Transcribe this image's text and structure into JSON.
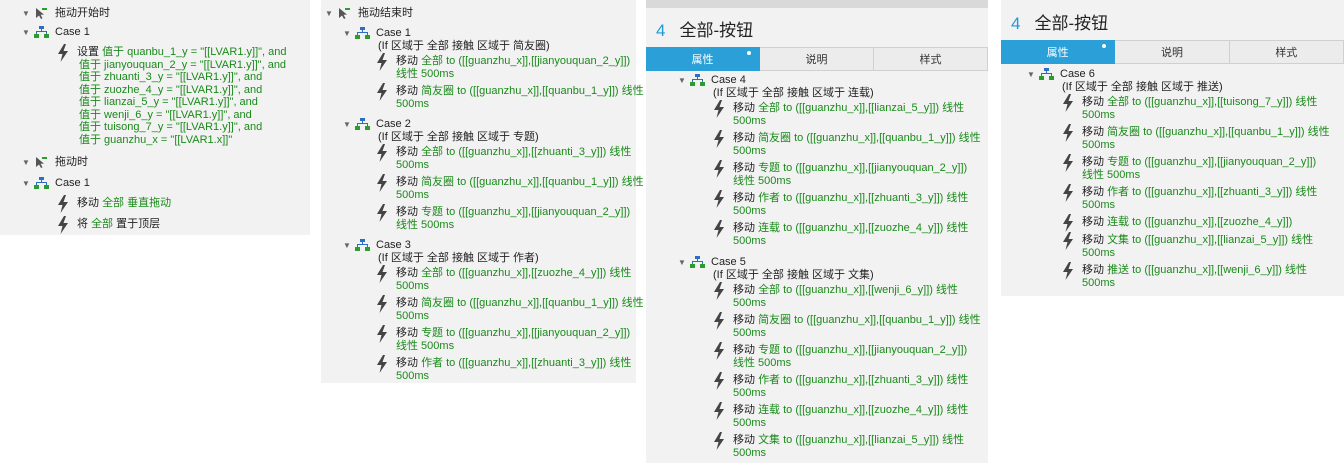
{
  "panel1": {
    "event1": "拖动开始时",
    "case1": "Case 1",
    "set_lines": [
      {
        "a": "设置 ",
        "g": "值于 quanbu_1_y = \"[[LVAR1.y]]\", and"
      },
      {
        "a": "",
        "g": "值于 jianyouquan_2_y = \"[[LVAR1.y]]\", and"
      },
      {
        "a": "",
        "g": "值于 zhuanti_3_y = \"[[LVAR1.y]]\", and"
      },
      {
        "a": "",
        "g": "值于 zuozhe_4_y = \"[[LVAR1.y]]\", and"
      },
      {
        "a": "",
        "g": "值于 lianzai_5_y = \"[[LVAR1.y]]\", and"
      },
      {
        "a": "",
        "g": "值于 wenji_6_y = \"[[LVAR1.y]]\", and"
      },
      {
        "a": "",
        "g": "值于 tuisong_7_y = \"[[LVAR1.y]]\", and"
      },
      {
        "a": "",
        "g": "值于 guanzhu_x = \"[[LVAR1.x]]\""
      }
    ],
    "event2": "拖动时",
    "case2": "Case 1",
    "act1": {
      "a": "移动 ",
      "g": "全部 垂直拖动"
    },
    "act2": {
      "a": "将 ",
      "g": "全部",
      "b": " 置于顶层"
    }
  },
  "panel2": {
    "event": "拖动结束时",
    "cases": [
      {
        "name": "Case 1",
        "cond": "(If 区域于 全部 接触 区域于 简友圈)",
        "acts": [
          {
            "a": "移动 ",
            "g": "全部 to ([[guanzhu_x]],[[jianyouquan_2_y]])",
            "g2": "线性 500ms"
          },
          {
            "a": "移动 ",
            "g": "简友圈 to ([[guanzhu_x]],[[quanbu_1_y]]) 线性",
            "g2": "500ms"
          }
        ]
      },
      {
        "name": "Case 2",
        "cond": "(If 区域于 全部 接触 区域于 专题)",
        "acts": [
          {
            "a": "移动 ",
            "g": "全部 to ([[guanzhu_x]],[[zhuanti_3_y]]) 线性",
            "g2": "500ms"
          },
          {
            "a": "移动 ",
            "g": "简友圈 to ([[guanzhu_x]],[[quanbu_1_y]]) 线性",
            "g2": "500ms"
          },
          {
            "a": "移动 ",
            "g": "专题 to ([[guanzhu_x]],[[jianyouquan_2_y]])",
            "g2": "线性 500ms"
          }
        ]
      },
      {
        "name": "Case 3",
        "cond": "(If 区域于 全部 接触 区域于 作者)",
        "acts": [
          {
            "a": "移动 ",
            "g": "全部 to ([[guanzhu_x]],[[zuozhe_4_y]]) 线性",
            "g2": "500ms"
          },
          {
            "a": "移动 ",
            "g": "简友圈 to ([[guanzhu_x]],[[quanbu_1_y]]) 线性",
            "g2": "500ms"
          },
          {
            "a": "移动 ",
            "g": "专题 to ([[guanzhu_x]],[[jianyouquan_2_y]])",
            "g2": "线性 500ms"
          },
          {
            "a": "移动 ",
            "g": "作者 to ([[guanzhu_x]],[[zhuanti_3_y]]) 线性",
            "g2": "500ms"
          }
        ]
      }
    ]
  },
  "panel3": {
    "num": "4",
    "title": "全部-按钮",
    "tabs": [
      "属性",
      "说明",
      "样式"
    ],
    "cases": [
      {
        "name": "Case 4",
        "cond": "(If 区域于 全部 接触 区域于 连载)",
        "acts": [
          {
            "a": "移动 ",
            "g": "全部 to ([[guanzhu_x]],[[lianzai_5_y]]) 线性",
            "g2": "500ms"
          },
          {
            "a": "移动 ",
            "g": "简友圈 to ([[guanzhu_x]],[[quanbu_1_y]]) 线性",
            "g2": "500ms"
          },
          {
            "a": "移动 ",
            "g": "专题 to ([[guanzhu_x]],[[jianyouquan_2_y]])",
            "g2": "线性 500ms"
          },
          {
            "a": "移动 ",
            "g": "作者 to ([[guanzhu_x]],[[zhuanti_3_y]]) 线性",
            "g2": "500ms"
          },
          {
            "a": "移动 ",
            "g": "连载 to ([[guanzhu_x]],[[zuozhe_4_y]]) 线性",
            "g2": "500ms"
          }
        ]
      },
      {
        "name": "Case 5",
        "cond": "(If 区域于 全部 接触 区域于 文集)",
        "acts": [
          {
            "a": "移动 ",
            "g": "全部 to ([[guanzhu_x]],[[wenji_6_y]]) 线性",
            "g2": "500ms"
          },
          {
            "a": "移动 ",
            "g": "简友圈 to ([[guanzhu_x]],[[quanbu_1_y]]) 线性",
            "g2": "500ms"
          },
          {
            "a": "移动 ",
            "g": "专题 to ([[guanzhu_x]],[[jianyouquan_2_y]])",
            "g2": "线性 500ms"
          },
          {
            "a": "移动 ",
            "g": "作者 to ([[guanzhu_x]],[[zhuanti_3_y]]) 线性",
            "g2": "500ms"
          },
          {
            "a": "移动 ",
            "g": "连载 to ([[guanzhu_x]],[[zuozhe_4_y]]) 线性",
            "g2": "500ms"
          },
          {
            "a": "移动 ",
            "g": "文集 to ([[guanzhu_x]],[[lianzai_5_y]]) 线性",
            "g2": "500ms"
          }
        ]
      }
    ]
  },
  "panel4": {
    "num": "4",
    "title": "全部-按钮",
    "tabs": [
      "属性",
      "说明",
      "样式"
    ],
    "cases": [
      {
        "name": "Case 6",
        "cond": "(If 区域于 全部 接触 区域于 推送)",
        "acts": [
          {
            "a": "移动 ",
            "g": "全部 to ([[guanzhu_x]],[[tuisong_7_y]]) 线性",
            "g2": "500ms"
          },
          {
            "a": "移动 ",
            "g": "简友圈 to ([[guanzhu_x]],[[quanbu_1_y]]) 线性",
            "g2": "500ms"
          },
          {
            "a": "移动 ",
            "g": "专题 to ([[guanzhu_x]],[[jianyouquan_2_y]])",
            "g2": "线性 500ms"
          },
          {
            "a": "移动 ",
            "g": "作者 to ([[guanzhu_x]],[[zhuanti_3_y]]) 线性",
            "g2": "500ms"
          },
          {
            "a": "移动 ",
            "g": "连载 to ([[guanzhu_x]],[[zuozhe_4_y]])",
            "g2": ""
          },
          {
            "a": "移动 ",
            "g": "文集 to ([[guanzhu_x]],[[lianzai_5_y]]) 线性",
            "g2": "500ms"
          },
          {
            "a": "移动 ",
            "g": "推送 to ([[guanzhu_x]],[[wenji_6_y]]) 线性",
            "g2": "500ms"
          }
        ]
      }
    ]
  },
  "colors": {
    "accent": "#2a9fd8",
    "action_green": "#1a8a1a",
    "panel_bg": "#f2f2f2"
  }
}
